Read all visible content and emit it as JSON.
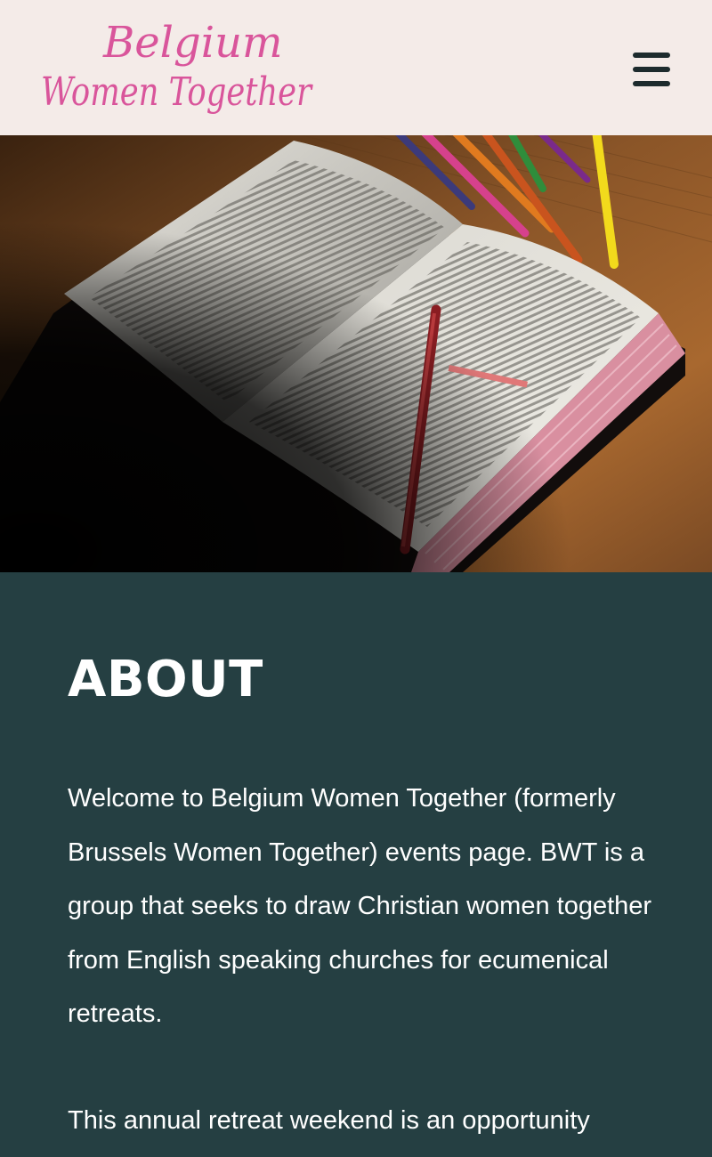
{
  "header": {
    "logo_line1": "Belgium",
    "logo_line2": "Women Together",
    "menu_icon": "hamburger-menu-icon",
    "logo_color": "#d9559b"
  },
  "hero": {
    "image": "open bible with pencils on a wooden table"
  },
  "about": {
    "heading": "ABOUT",
    "paragraph1": "Welcome to Belgium Women Together (formerly Brussels Women Together) events page. BWT is a group that seeks to draw Christian women together from English speaking churches for ecumenical retreats.",
    "paragraph2": "This annual retreat weekend is an opportunity"
  },
  "colors": {
    "header_bg": "#f4ebe8",
    "section_bg": "#253f42",
    "text": "#ffffff",
    "icon": "#1d2b2d"
  }
}
